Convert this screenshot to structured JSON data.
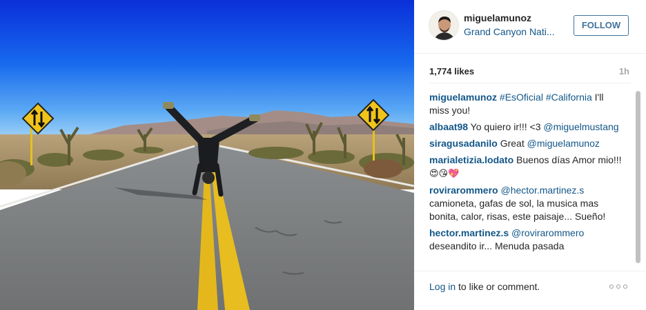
{
  "post": {
    "username": "miguelamunoz",
    "location": "Grand Canyon Nati...",
    "follow_label": "FOLLOW",
    "likes": "1,774 likes",
    "time_ago": "1h"
  },
  "caption": {
    "author": "miguelamunoz",
    "hashtag1": "#EsOficial",
    "hashtag2": "#California",
    "text": " I'll miss you!"
  },
  "comments": [
    {
      "author": "albaat98",
      "text": " Yo quiero ir!!! <3 ",
      "mention": "@miguelmustang"
    },
    {
      "author": "siragusadanilo",
      "text": " Great ",
      "mention": "@miguelamunoz"
    },
    {
      "author": "marialetizia.lodato",
      "text": " Buenos días Amor mio!!! ",
      "emoji": "😍😘💖"
    },
    {
      "author": "rovirarommero",
      "mention": "@hector.martinez.s",
      "text": " camioneta, gafas de sol, la musica mas bonita, calor, risas, este paisaje... Sueño!"
    },
    {
      "author": "hector.martinez.s",
      "mention": "@rovirarommero",
      "text": " deseandito ir... Menuda pasada"
    }
  ],
  "footer": {
    "login_link": "Log in",
    "login_suffix": " to like or comment."
  },
  "colors": {
    "link_blue": "#125688",
    "follow_blue": "#3f729b",
    "muted_grey": "#a5a7aa"
  },
  "icons": {
    "more_options": "ellipsis-icon",
    "road_sign": "two-way-traffic-sign"
  }
}
